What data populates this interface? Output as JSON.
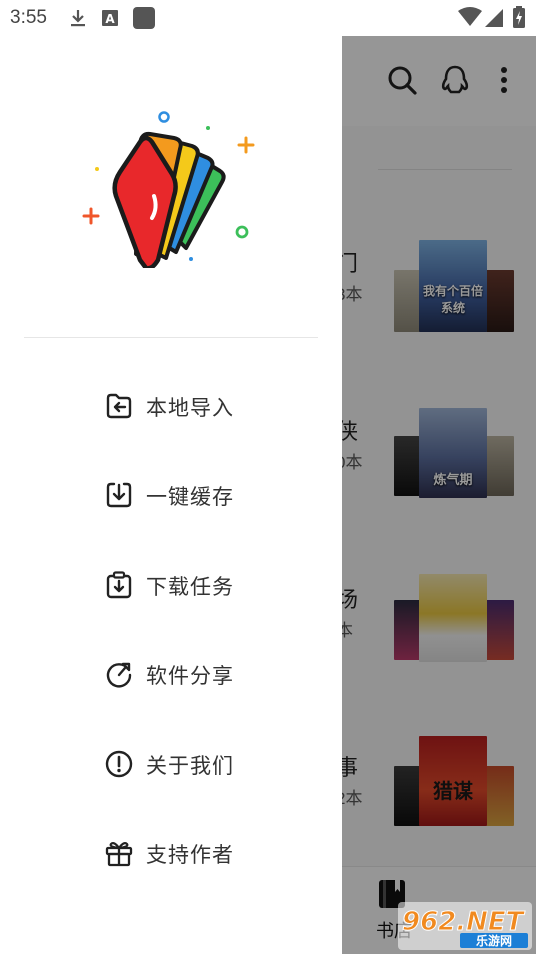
{
  "status_bar": {
    "time": "3:55",
    "left_icons": [
      "download-icon",
      "text-a-icon",
      "app-square-icon"
    ],
    "right_icons": [
      "wifi-icon",
      "signal-icon",
      "battery-charging-icon"
    ]
  },
  "background_app": {
    "toolbar_icons": [
      "search-icon",
      "qq-icon",
      "more-vert-icon"
    ],
    "categories": [
      {
        "name_partial": "门",
        "count_partial": "3本"
      },
      {
        "name_partial": "侠",
        "count_partial": "0本"
      },
      {
        "name_partial": "场",
        "count_partial": "本"
      },
      {
        "name_partial": "事",
        "count_partial": "2本"
      }
    ],
    "covers": {
      "row1_center_title": "我有个百倍系统",
      "row2_center_title": "炼气期",
      "row4_center_title": "猎谋"
    },
    "bottom_nav": {
      "label_partial": "书店",
      "icon": "book-icon"
    }
  },
  "drawer": {
    "logo_icon": "reader-app-logo-icon",
    "menu": [
      {
        "label": "本地导入",
        "icon": "folder-import-icon"
      },
      {
        "label": "一键缓存",
        "icon": "download-box-icon"
      },
      {
        "label": "下载任务",
        "icon": "download-task-icon"
      },
      {
        "label": "软件分享",
        "icon": "share-rotate-icon"
      },
      {
        "label": "关于我们",
        "icon": "info-exclamation-icon"
      },
      {
        "label": "支持作者",
        "icon": "gift-icon"
      }
    ]
  },
  "watermark": {
    "brand": "962.NET",
    "sub": "乐游网"
  },
  "colors": {
    "scrim": "#000000",
    "drawer_bg": "#ffffff",
    "text": "#333333",
    "logo_red": "#e8282b",
    "logo_orange": "#f39a1e",
    "logo_yellow": "#f4c91a",
    "logo_blue": "#2f8ee0",
    "logo_green": "#3cbf5a"
  }
}
